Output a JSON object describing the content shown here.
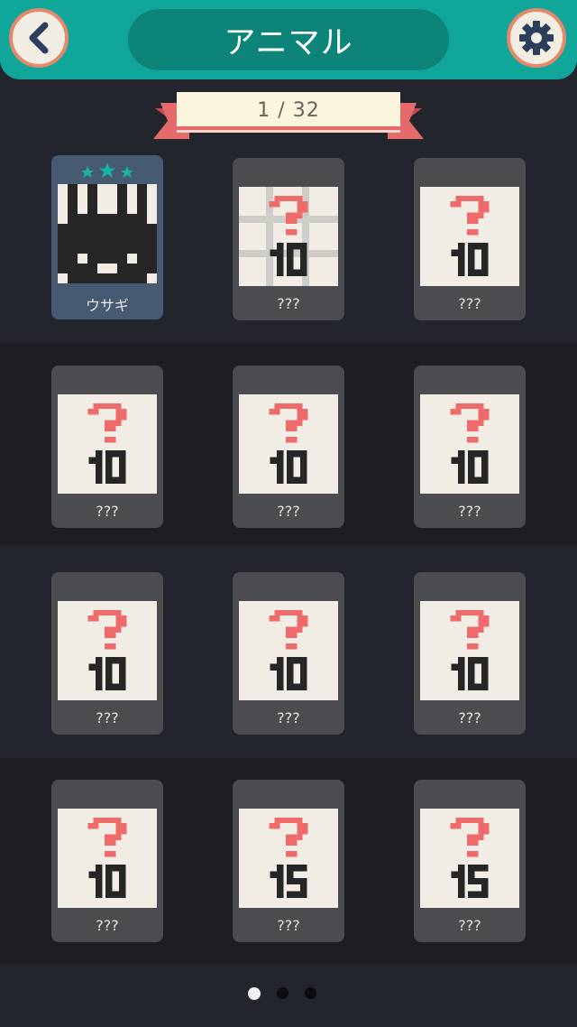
{
  "header": {
    "title": "アニマル"
  },
  "pager": {
    "progress": "1 / 32"
  },
  "colors": {
    "header_bg": "#11a69a",
    "title_pill": "#0c8578",
    "button_ring": "#e4876a",
    "question_mark": "#ef6b6b",
    "card_locked": "#4b4c50",
    "card_cleared": "#465a72",
    "star": "#17b3a3"
  },
  "puzzles": [
    {
      "label": "ウサギ",
      "cleared": true,
      "stars": 3,
      "icon": "rabbit-pixel-art"
    },
    {
      "label": "???",
      "cleared": false,
      "size": "10"
    },
    {
      "label": "???",
      "cleared": false,
      "size": "10"
    },
    {
      "label": "???",
      "cleared": false,
      "size": "10"
    },
    {
      "label": "???",
      "cleared": false,
      "size": "10"
    },
    {
      "label": "???",
      "cleared": false,
      "size": "10"
    },
    {
      "label": "???",
      "cleared": false,
      "size": "10"
    },
    {
      "label": "???",
      "cleared": false,
      "size": "10"
    },
    {
      "label": "???",
      "cleared": false,
      "size": "10"
    },
    {
      "label": "???",
      "cleared": false,
      "size": "10"
    },
    {
      "label": "???",
      "cleared": false,
      "size": "15"
    },
    {
      "label": "???",
      "cleared": false,
      "size": "15"
    }
  ],
  "pagination": {
    "pages": 3,
    "current": 1
  }
}
